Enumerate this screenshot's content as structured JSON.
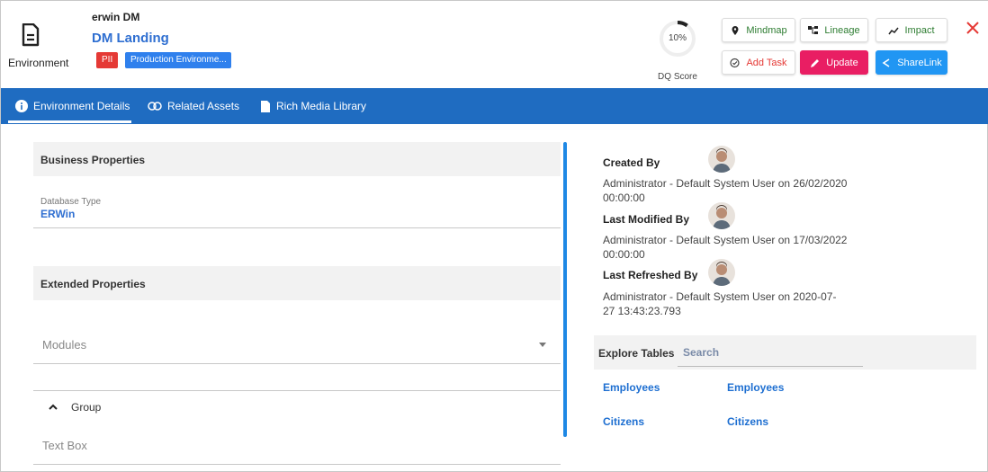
{
  "header": {
    "supertitle": "erwin DM",
    "title": "DM Landing",
    "object_type": "Environment",
    "tags": [
      "PII",
      "Production Environme..."
    ],
    "dq_score": {
      "value": "10%",
      "label": "DQ Score",
      "fraction": 0.1
    }
  },
  "actions": {
    "mindmap": "Mindmap",
    "lineage": "Lineage",
    "impact": "Impact",
    "add_task": "Add Task",
    "update": "Update",
    "sharelink": "ShareLink"
  },
  "tabs": [
    "Environment Details",
    "Related Assets",
    "Rich Media Library"
  ],
  "business_properties": {
    "heading": "Business Properties",
    "database_type_label": "Database Type",
    "database_type_value": "ERWin"
  },
  "extended_properties": {
    "heading": "Extended Properties",
    "modules_placeholder": "Modules",
    "group_label": "Group",
    "text_box_placeholder": "Text Box"
  },
  "metadata": {
    "created_by_label": "Created By",
    "created_by_text": "Administrator - Default System User on 26/02/2020 00:00:00",
    "last_modified_label": "Last Modified By",
    "last_modified_text": "Administrator - Default System User on 17/03/2022 00:00:00",
    "last_refreshed_label": "Last Refreshed By",
    "last_refreshed_text": "Administrator - Default System User on 2020-07-27 13:43:23.793"
  },
  "explore": {
    "heading": "Explore Tables",
    "search_placeholder": "Search",
    "tables": [
      "Employees",
      "Employees",
      "Citizens",
      "Citizens"
    ]
  },
  "colors": {
    "accent_blue": "#1f6cc1",
    "link_blue": "#2f6fd1",
    "pii_red": "#e53935",
    "update_pink": "#e91e63",
    "share_blue": "#2196f3",
    "action_green": "#2e7d32"
  }
}
